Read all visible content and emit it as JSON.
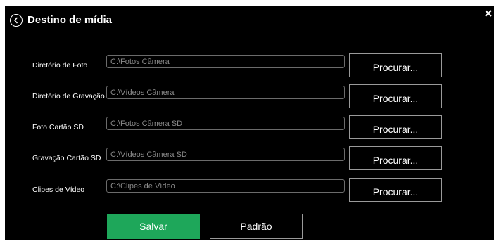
{
  "dialog": {
    "title": "Destino de mídia",
    "back_icon": "circle-chevron-left-icon",
    "close_icon": "close-x-icon"
  },
  "rows": [
    {
      "label": "Diretório de Foto",
      "value": "C:\\Fotos Câmera",
      "button": "Procurar..."
    },
    {
      "label": "Diretório de Gravação",
      "value": "C:\\Vídeos Câmera",
      "button": "Procurar..."
    },
    {
      "label": "Foto Cartão SD",
      "value": "C:\\Fotos Câmera SD",
      "button": "Procurar..."
    },
    {
      "label": "Gravação Cartão SD",
      "value": "C:\\Vídeos Câmera SD",
      "button": "Procurar..."
    },
    {
      "label": "Clipes de Vídeo",
      "value": "C:\\Clipes de Vídeo",
      "button": "Procurar..."
    }
  ],
  "actions": {
    "save": "Salvar",
    "default": "Padrão"
  },
  "colors": {
    "background": "#000000",
    "accent": "#1ea75a",
    "text": "#ffffff",
    "input_text": "#8a8a8a"
  }
}
